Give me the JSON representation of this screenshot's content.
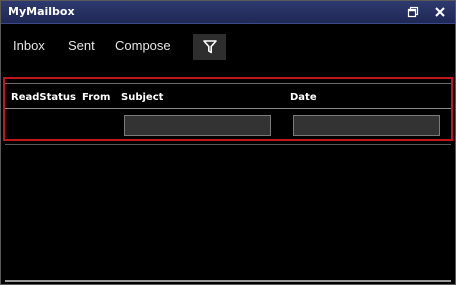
{
  "window": {
    "title": "MyMailbox",
    "controls": {
      "restore_icon": "restore-icon",
      "close_icon": "close-icon"
    }
  },
  "nav": {
    "items": [
      {
        "label": "Inbox"
      },
      {
        "label": "Sent"
      },
      {
        "label": "Compose"
      }
    ],
    "filter_icon": "filter-icon"
  },
  "grid": {
    "columns": [
      {
        "label": "ReadStatus"
      },
      {
        "label": "From"
      },
      {
        "label": "Subject"
      },
      {
        "label": "Date"
      }
    ],
    "filters": {
      "subject_value": "",
      "date_value": ""
    },
    "rows": []
  },
  "colors": {
    "titlebar": "#1f2856",
    "background": "#000000",
    "highlight_border": "#c0161c",
    "input_bg": "#333333"
  }
}
